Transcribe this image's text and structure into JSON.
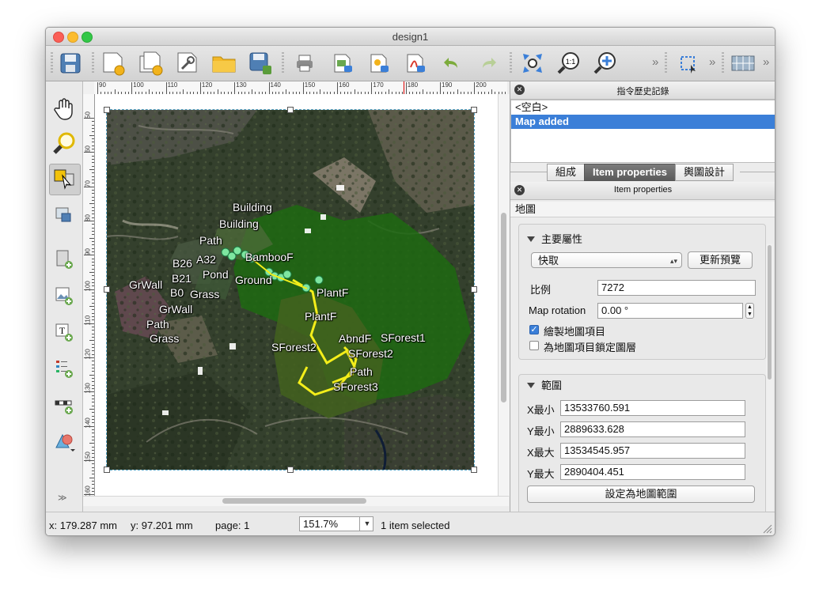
{
  "window": {
    "title": "design1"
  },
  "toolbar": {
    "items": [
      "save-icon",
      "new-composer-icon",
      "duplicate-composer-icon",
      "composer-manager-icon",
      "open-folder-icon",
      "save-as-template-icon",
      "print-icon",
      "export-image-icon",
      "export-svg-icon",
      "export-pdf-icon",
      "undo-icon",
      "redo-icon",
      "zoom-full-icon",
      "zoom-actual-icon",
      "zoom-in-icon",
      "select-move-icon",
      "atlas-icon"
    ],
    "overflow_label": "»"
  },
  "ruler": {
    "h_labels": [
      "90",
      "100",
      "110",
      "120",
      "130",
      "140",
      "150",
      "160",
      "170",
      "180",
      "190",
      "200"
    ],
    "v_labels": [
      "50",
      "60",
      "70",
      "80",
      "90",
      "100",
      "110",
      "120",
      "130",
      "140",
      "150",
      "160"
    ]
  },
  "map_labels": [
    "Building",
    "Building",
    "Path",
    "B26",
    "A32",
    "BambooF",
    "B21",
    "Pond",
    "Ground",
    "GrWall",
    "B0",
    "Grass",
    "PlantF",
    "GrWall",
    "PlantF",
    "Path",
    "SForest1",
    "SForest2",
    "AbndF",
    "Grass",
    "SForest2",
    "Path",
    "SForest3"
  ],
  "command_history": {
    "title": "指令歷史記錄",
    "items": [
      "<空白>",
      "Map added"
    ],
    "selected_index": 1
  },
  "tabs": [
    "組成",
    "Item properties",
    "輿圖設計"
  ],
  "item_properties": {
    "title": "Item properties",
    "section": "地圖",
    "main_group": "主要屬性",
    "cache_mode": "快取",
    "update_preview": "更新預覽",
    "scale_label": "比例",
    "scale_value": "7272",
    "rotation_label": "Map rotation",
    "rotation_value": "0.00 °",
    "draw_items_label": "繪製地圖項目",
    "draw_items_checked": true,
    "lock_layers_label": "為地圖項目鎖定圖層",
    "lock_layers_checked": false,
    "extent_group": "範圍",
    "xmin_label": "X最小",
    "xmin_value": "13533760.591",
    "ymin_label": "Y最小",
    "ymin_value": "2889633.628",
    "xmax_label": "X最大",
    "xmax_value": "13534545.957",
    "ymax_label": "Y最大",
    "ymax_value": "2890404.451",
    "set_extent_button": "設定為地圖範圍"
  },
  "status": {
    "x_coord": "x: 179.287 mm",
    "y_coord": "y: 97.201 mm",
    "page": "page: 1",
    "zoom": "151.7%",
    "selection": "1 item selected"
  }
}
